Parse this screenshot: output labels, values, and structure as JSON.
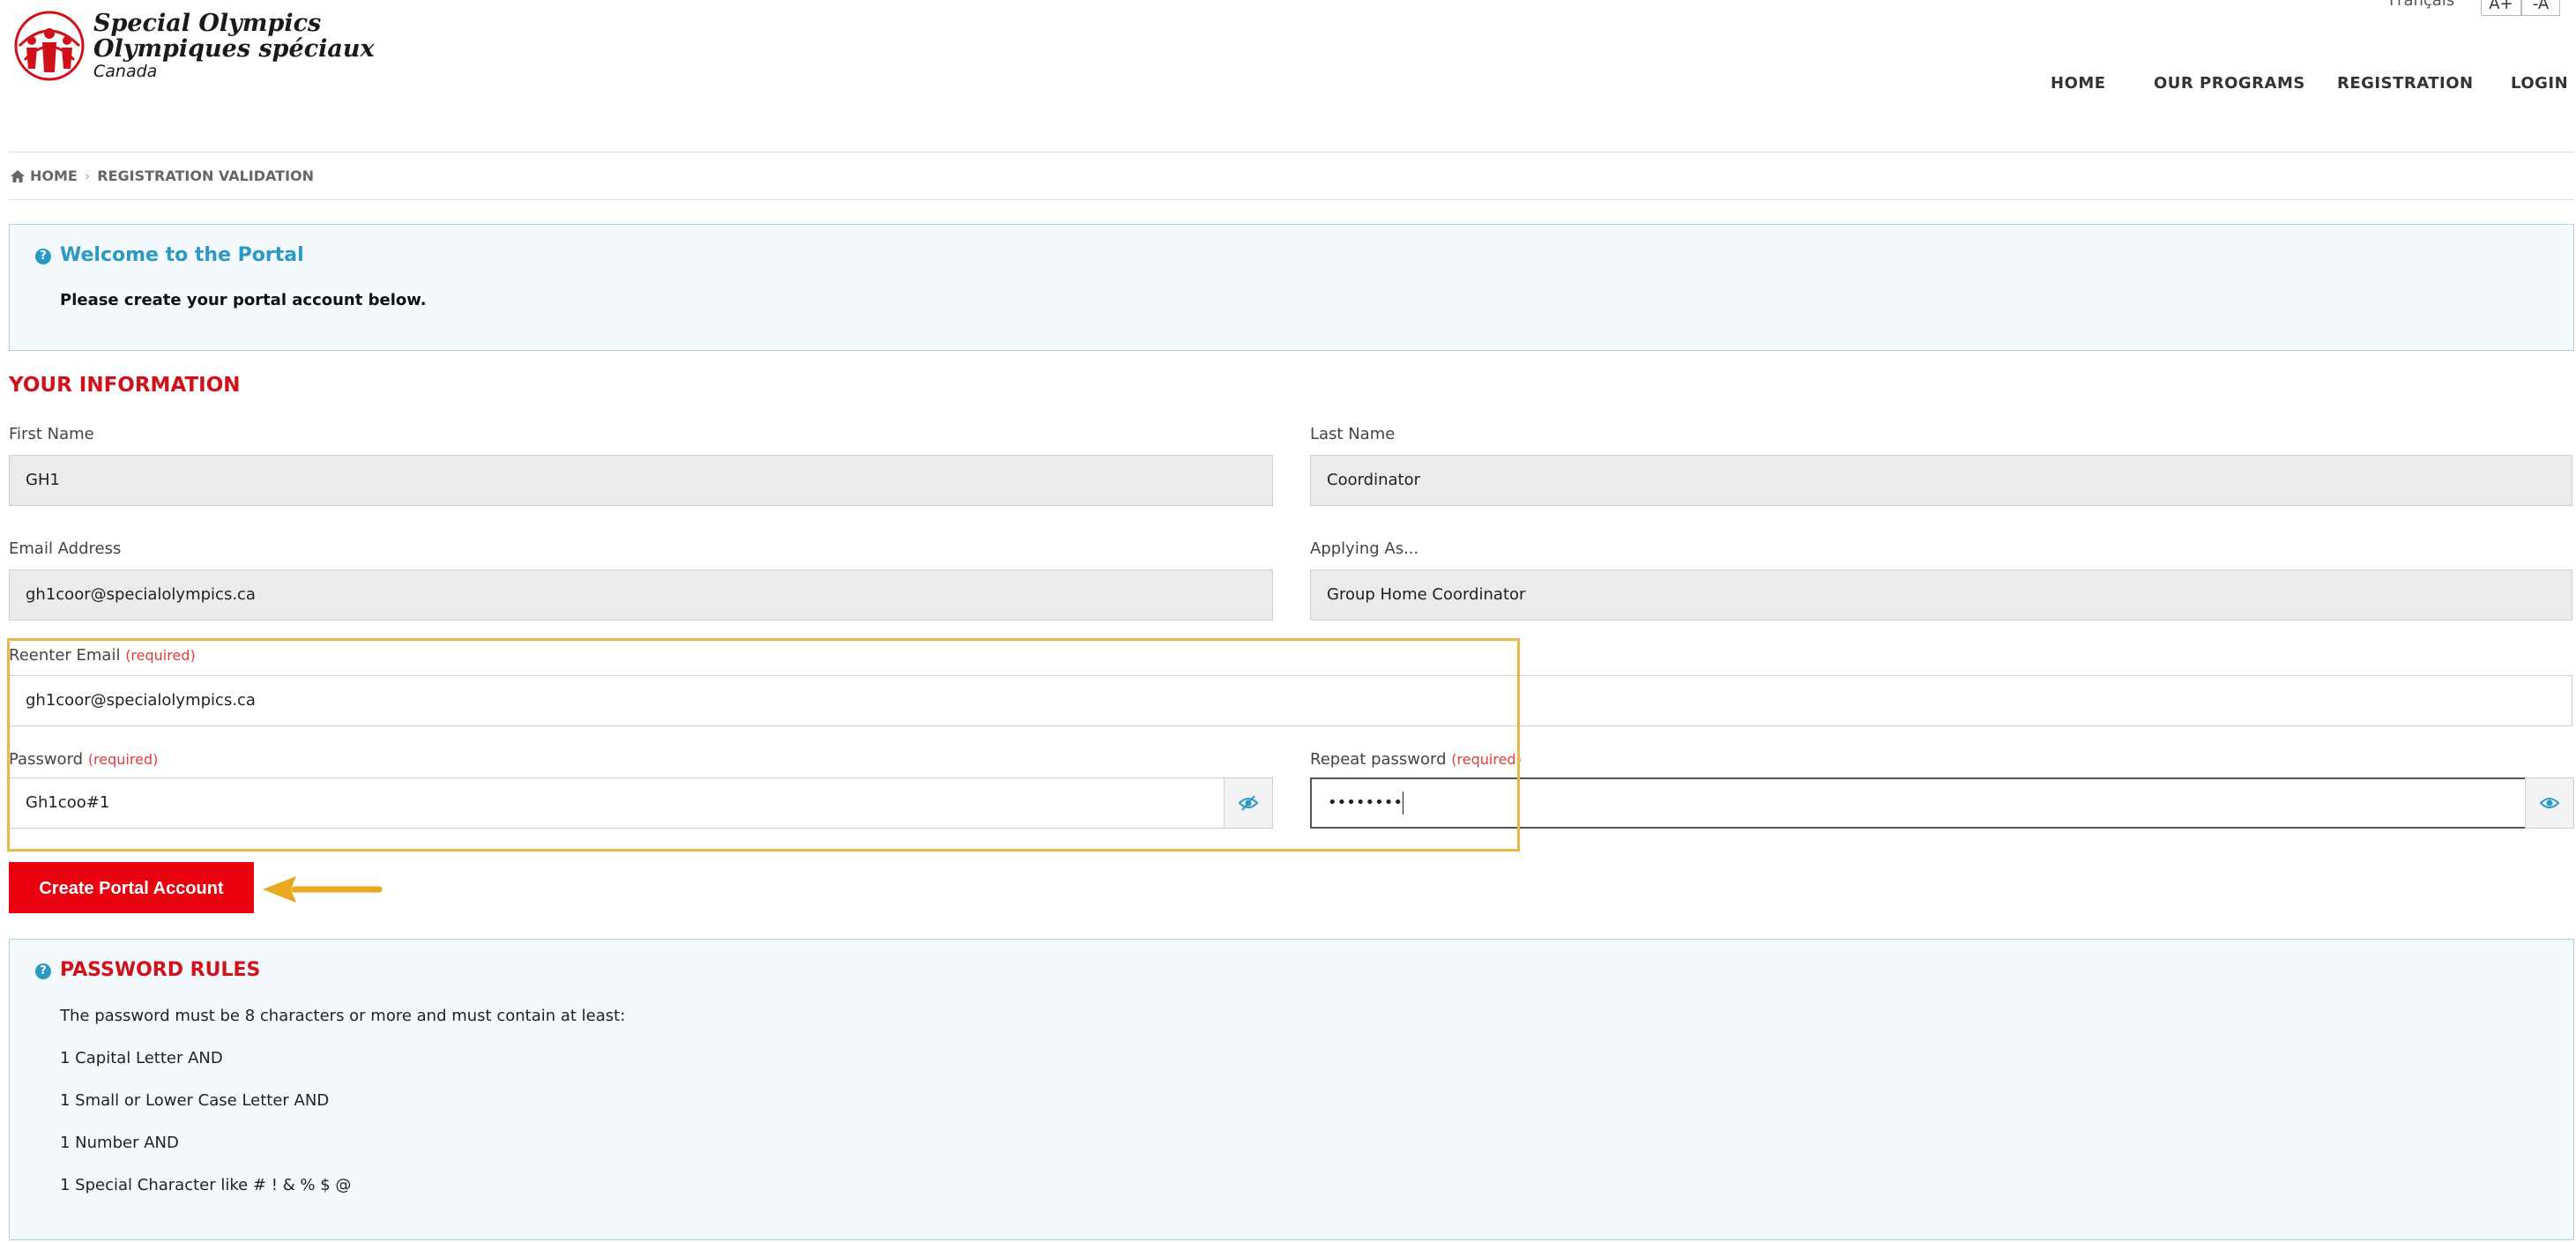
{
  "brand": {
    "line1": "Special Olympics",
    "line2": "Olympiques spéciaux",
    "line3": "Canada"
  },
  "top": {
    "language": "Français",
    "font_increase": "A+",
    "font_decrease": "-A"
  },
  "nav": {
    "items": [
      "HOME",
      "OUR PROGRAMS",
      "REGISTRATION",
      "LOGIN"
    ]
  },
  "breadcrumb": {
    "home": "HOME",
    "current": "REGISTRATION VALIDATION"
  },
  "welcome": {
    "title": "Welcome to the Portal",
    "text": "Please create your portal account below."
  },
  "section": {
    "title": "YOUR INFORMATION"
  },
  "form": {
    "first_name_label": "First Name",
    "first_name_value": "GH1",
    "last_name_label": "Last Name",
    "last_name_value": "Coordinator",
    "email_label": "Email Address",
    "email_value": "gh1coor@specialolympics.ca",
    "applying_label": "Applying As...",
    "applying_value": "Group Home Coordinator",
    "reenter_email_label": "Reenter Email",
    "reenter_email_value": "gh1coor@specialolympics.ca",
    "password_label": "Password",
    "password_value": "Gh1coo#1",
    "repeat_password_label": "Repeat password",
    "repeat_password_value": "••••••••",
    "required_text": "(required)"
  },
  "button": {
    "create_label": "Create Portal Account"
  },
  "rules": {
    "title": "PASSWORD RULES",
    "lines": [
      "The password must be 8 characters or more and must contain at least:",
      "1 Capital Letter AND",
      "1 Small or Lower Case Letter AND",
      "1 Number AND",
      "1 Special Character like # ! & % $ @"
    ]
  },
  "colors": {
    "accent_red": "#d0111a",
    "button_red": "#e8000e",
    "info_blue": "#2a9ac2",
    "highlight": "#e8b94a",
    "arrow": "#e8a820"
  }
}
